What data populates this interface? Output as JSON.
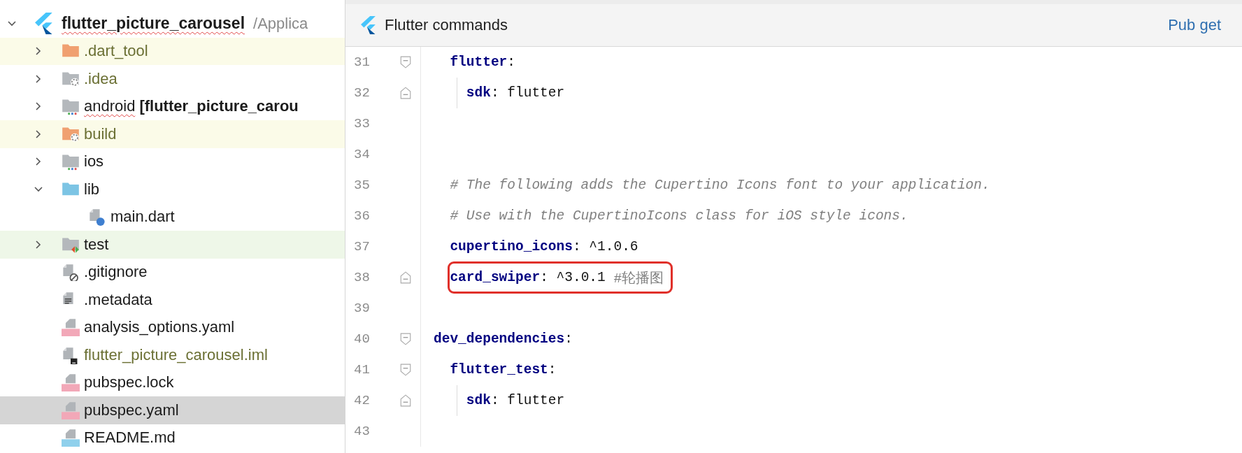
{
  "project_tree": {
    "root": {
      "name": "flutter_picture_carousel",
      "path": "/Applica",
      "expanded": true,
      "misspelled": true,
      "children": [
        {
          "name": ".dart_tool",
          "kind": "folder-orange",
          "expanded": false,
          "ignored": true,
          "excluded": true,
          "selected": false
        },
        {
          "name": ".idea",
          "kind": "folder-settings",
          "expanded": false,
          "ignored": true,
          "selected": false
        },
        {
          "name": "android",
          "suffix": "[flutter_picture_carou",
          "kind": "folder-module",
          "expanded": false,
          "misspelled": true,
          "selected": false
        },
        {
          "name": "build",
          "kind": "folder-orange-settings",
          "expanded": false,
          "ignored": true,
          "excluded": true,
          "selected": false
        },
        {
          "name": "ios",
          "kind": "folder-module",
          "expanded": false,
          "selected": false
        },
        {
          "name": "lib",
          "kind": "folder-blue",
          "expanded": true,
          "selected": false,
          "children": [
            {
              "name": "main.dart",
              "kind": "dart",
              "selected": false
            }
          ]
        },
        {
          "name": "test",
          "kind": "folder-test",
          "expanded": false,
          "test_source": true,
          "selected": false
        },
        {
          "name": ".gitignore",
          "kind": "ignore",
          "selected": false
        },
        {
          "name": ".metadata",
          "kind": "text",
          "selected": false
        },
        {
          "name": "analysis_options.yaml",
          "kind": "yaml",
          "selected": false
        },
        {
          "name": "flutter_picture_carousel.iml",
          "kind": "iml",
          "ignored": true,
          "selected": false
        },
        {
          "name": "pubspec.lock",
          "kind": "yaml",
          "selected": false
        },
        {
          "name": "pubspec.yaml",
          "kind": "yaml",
          "selected": true
        },
        {
          "name": "README.md",
          "kind": "md",
          "selected": false
        }
      ]
    }
  },
  "editor": {
    "banner": {
      "title": "Flutter commands",
      "action": "Pub get"
    },
    "lines": [
      {
        "children": [
          {
            "number": "31",
            "fold_start": true,
            "code": [
              {
                "kind": "key",
                "text": "flutter"
              },
              {
                "kind": "plain",
                "text": ":"
              }
            ],
            "children": [
              {
                "number": "32",
                "fold_end": true,
                "code": [
                  {
                    "kind": "key",
                    "text": "sdk"
                  },
                  {
                    "kind": "plain",
                    "text": ": flutter"
                  }
                ]
              }
            ]
          },
          {
            "number": "33"
          },
          {
            "number": "34"
          },
          {
            "number": "35",
            "code": [
              {
                "kind": "comment",
                "text": "# The following adds the Cupertino Icons font to your application."
              }
            ]
          },
          {
            "number": "36",
            "code": [
              {
                "kind": "comment",
                "text": "# Use with the CupertinoIcons class for iOS style icons."
              }
            ]
          },
          {
            "number": "37",
            "code": [
              {
                "kind": "key",
                "text": "cupertino_icons"
              },
              {
                "kind": "plain",
                "text": ": ^1.0.6"
              }
            ]
          },
          {
            "number": "38",
            "fold_end": true,
            "highlighted": true,
            "code": [
              {
                "kind": "key",
                "text": "card_swiper"
              },
              {
                "kind": "plain",
                "text": ": ^3.0.1 "
              },
              {
                "kind": "comment-plain",
                "text": "#轮播图"
              }
            ]
          },
          {
            "number": "39"
          }
        ]
      },
      {
        "number": "40",
        "fold_start": true,
        "code": [
          {
            "kind": "key",
            "text": "dev_dependencies"
          },
          {
            "kind": "plain",
            "text": ":"
          }
        ],
        "children": [
          {
            "number": "41",
            "fold_start": true,
            "code": [
              {
                "kind": "key",
                "text": "flutter_test"
              },
              {
                "kind": "plain",
                "text": ":"
              }
            ],
            "children": [
              {
                "number": "42",
                "fold_end": true,
                "code": [
                  {
                    "kind": "key",
                    "text": "sdk"
                  },
                  {
                    "kind": "plain",
                    "text": ": flutter"
                  }
                ]
              }
            ]
          }
        ]
      },
      {
        "number": "43"
      }
    ]
  }
}
